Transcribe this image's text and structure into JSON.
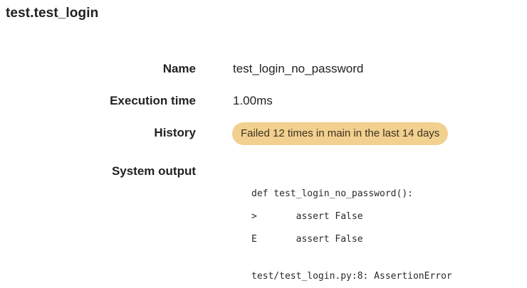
{
  "page": {
    "title": "test.test_login"
  },
  "details": {
    "name_label": "Name",
    "name_value": "test_login_no_password",
    "execution_time_label": "Execution time",
    "execution_time_value": "1.00ms",
    "history_label": "History",
    "history_badge": "Failed 12 times in main in the last 14 days",
    "history_badge_color": "#f2d08f",
    "system_output_label": "System output"
  },
  "system_output": {
    "lines": [
      "def test_login_no_password():",
      ">       assert False",
      "E       assert False",
      "",
      "test/test_login.py:8: AssertionError"
    ]
  }
}
